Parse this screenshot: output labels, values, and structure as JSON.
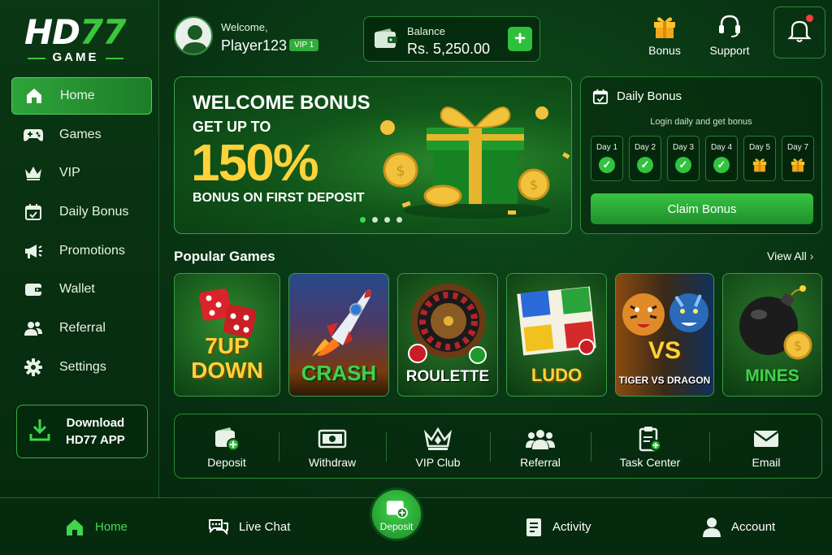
{
  "brand": {
    "logo_hd": "HD",
    "logo_num": "77",
    "logo_sub": "GAME"
  },
  "sidebar": {
    "items": [
      {
        "label": "Home",
        "icon": "home-icon",
        "active": true
      },
      {
        "label": "Games",
        "icon": "gamepad-icon"
      },
      {
        "label": "VIP",
        "icon": "crown-icon"
      },
      {
        "label": "Daily Bonus",
        "icon": "calendar-icon"
      },
      {
        "label": "Promotions",
        "icon": "megaphone-icon"
      },
      {
        "label": "Wallet",
        "icon": "wallet-icon"
      },
      {
        "label": "Referral",
        "icon": "users-icon"
      },
      {
        "label": "Settings",
        "icon": "gear-icon"
      }
    ],
    "download": {
      "line1": "Download",
      "line2": "HD77 APP"
    }
  },
  "header": {
    "welcome": "Welcome,",
    "player": "Player123",
    "vip": "VIP 1",
    "balance_label": "Balance",
    "balance_value": "Rs. 5,250.00",
    "plus": "+",
    "bonus": "Bonus",
    "support": "Support"
  },
  "banner": {
    "title": "WELCOME BONUS",
    "get_up_to": "GET UP TO",
    "percent": "150%",
    "subtitle": "BONUS ON FIRST DEPOSIT",
    "slides": 4,
    "active_slide": 1
  },
  "daily_bonus": {
    "title": "Daily Bonus",
    "subtitle": "Login daily and get bonus",
    "days": [
      {
        "label": "Day 1",
        "status": "claimed"
      },
      {
        "label": "Day 2",
        "status": "claimed"
      },
      {
        "label": "Day 3",
        "status": "claimed"
      },
      {
        "label": "Day 4",
        "status": "claimed"
      },
      {
        "label": "Day 5",
        "status": "gift"
      },
      {
        "label": "Day 7",
        "status": "gift"
      }
    ],
    "claim": "Claim Bonus"
  },
  "popular": {
    "title": "Popular Games",
    "view_all": "View All",
    "games": [
      {
        "title": "7 UP DOWN",
        "line1": "7UP",
        "line2": "DOWN"
      },
      {
        "title": "CRASH"
      },
      {
        "title": "ROULETTE"
      },
      {
        "title": "LUDO"
      },
      {
        "title": "TIGER VS DRAGON",
        "vs": "VS"
      },
      {
        "title": "MINES"
      }
    ]
  },
  "quick": [
    {
      "label": "Deposit",
      "icon": "wallet-plus-icon"
    },
    {
      "label": "Withdraw",
      "icon": "cash-icon"
    },
    {
      "label": "VIP Club",
      "icon": "crown-icon"
    },
    {
      "label": "Referral",
      "icon": "users-icon"
    },
    {
      "label": "Task Center",
      "icon": "clipboard-icon"
    },
    {
      "label": "Email",
      "icon": "mail-icon"
    }
  ],
  "bottom_nav": {
    "home": "Home",
    "live_chat": "Live Chat",
    "deposit": "Deposit",
    "activity": "Activity",
    "account": "Account"
  },
  "colors": {
    "accent": "#2fbf3c",
    "gold": "#ffd23a",
    "bg": "#073012",
    "alert": "#ff3b3b"
  }
}
